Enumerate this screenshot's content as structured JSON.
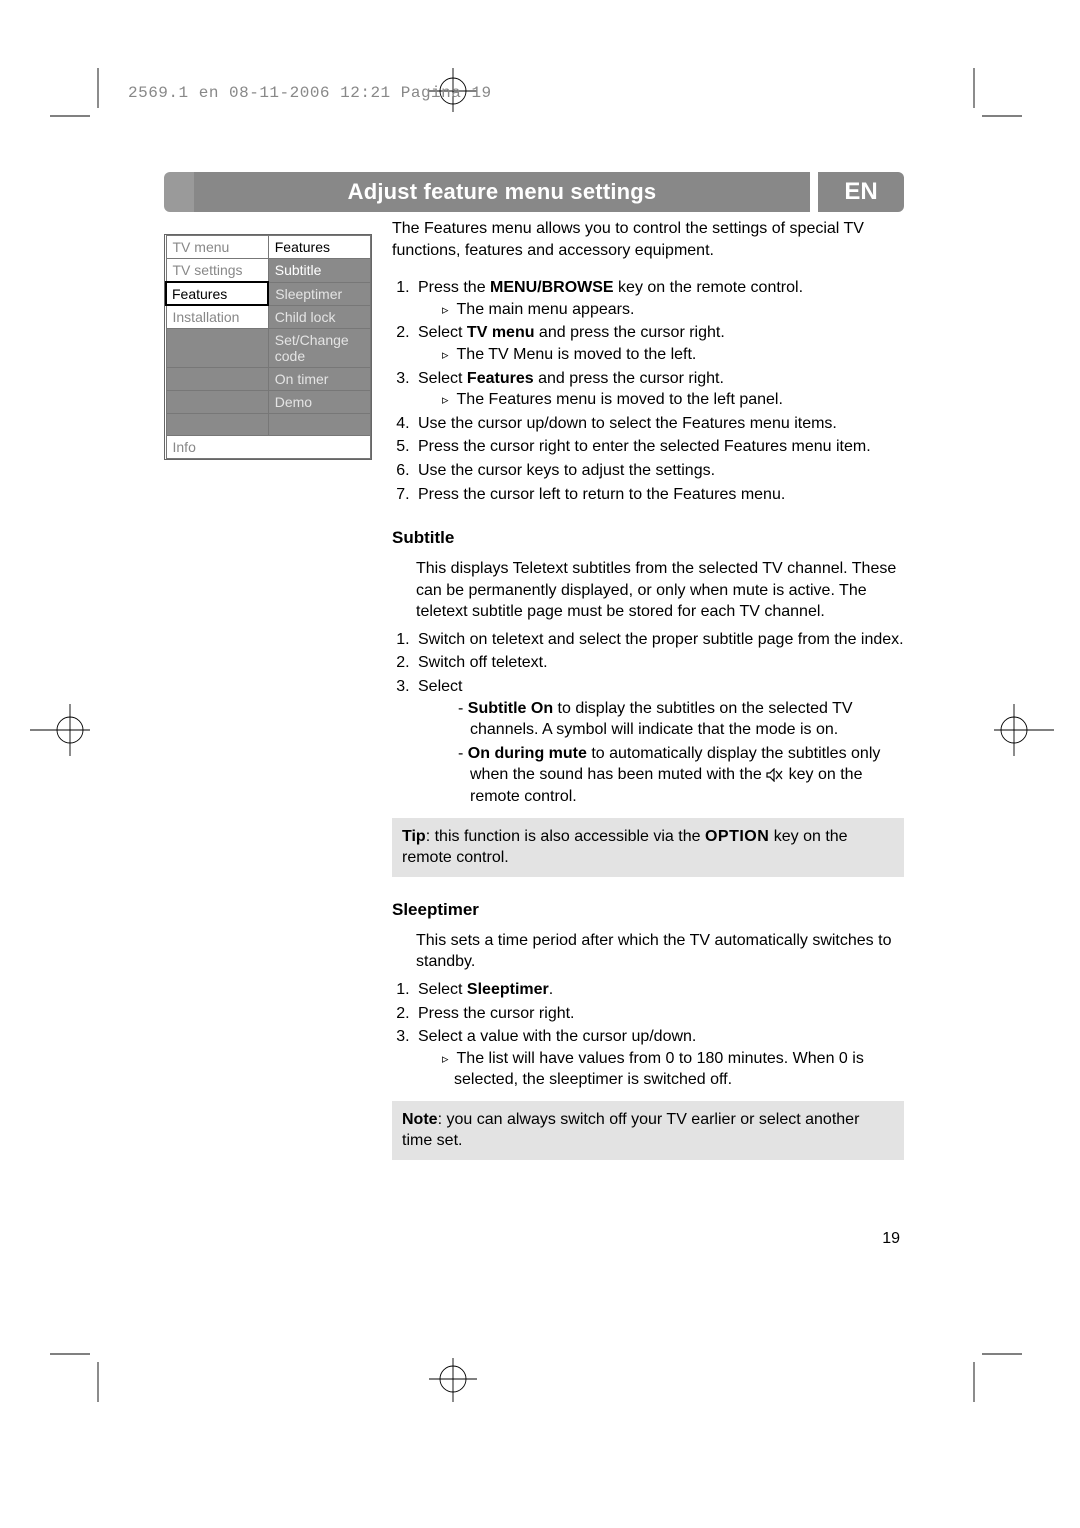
{
  "header": "2569.1 en  08-11-2006  12:21  Pagina 19",
  "title": "Adjust feature menu settings",
  "lang": "EN",
  "sidebar": {
    "col_l_header": "TV menu",
    "col_r_header": "Features",
    "left": {
      "row1": "TV settings",
      "row2": "Features",
      "row3": "Installation"
    },
    "right": {
      "row1": "Subtitle",
      "row2": "Sleeptimer",
      "row3": "Child lock",
      "row4": "Set/Change code",
      "row5": "On timer",
      "row6": "Demo"
    },
    "info": "Info"
  },
  "intro": "The Features menu allows you to control the settings of special TV functions, features and accessory equipment.",
  "steps": {
    "s1a": "Press the ",
    "s1b": "MENU/BROWSE",
    "s1c": " key on the remote control.",
    "s1r": "The main menu appears.",
    "s2a": "Select ",
    "s2b": "TV menu",
    "s2c": " and press the cursor right.",
    "s2r": "The TV Menu is moved to the left.",
    "s3a": "Select ",
    "s3b": "Features",
    "s3c": " and press the cursor right.",
    "s3r": "The Features menu is moved to the left panel.",
    "s4": "Use the cursor up/down to select the Features menu items.",
    "s5": "Press the cursor right to enter the selected Features menu item.",
    "s6": "Use the cursor keys to adjust the settings.",
    "s7": "Press the cursor left to return to the Features menu."
  },
  "subtitle": {
    "heading": "Subtitle",
    "body": "This displays Teletext subtitles from the selected TV channel. These can be permanently displayed, or only when mute is active. The teletext subtitle page must be stored for each TV channel.",
    "s1": "Switch on teletext and select the proper subtitle page from the index.",
    "s2": "Switch off teletext.",
    "s3": "Select",
    "d1a": "Subtitle On",
    "d1b": " to display the subtitles on the selected TV channels.  A symbol will indicate that the mode is on.",
    "d2a": "On during mute",
    "d2b": " to automatically display the subtitles only when the sound has been muted with the ",
    "d2c": " key on the remote control.",
    "tip_a": "Tip",
    "tip_b": ": this function is also accessible via the ",
    "tip_c": "OPTION",
    "tip_d": " key on the remote control."
  },
  "sleeptimer": {
    "heading": "Sleeptimer",
    "body": "This sets a time period after which the TV automatically switches to standby.",
    "s1a": "Select ",
    "s1b": "Sleeptimer",
    "s1c": ".",
    "s2": "Press the cursor right.",
    "s3": "Select a value with the cursor up/down.",
    "s3r": "The list will have values from 0 to 180 minutes. When 0 is selected, the sleeptimer is switched off.",
    "note_a": "Note",
    "note_b": ": you can always switch off your TV earlier or select another time set."
  },
  "page_number": "19"
}
